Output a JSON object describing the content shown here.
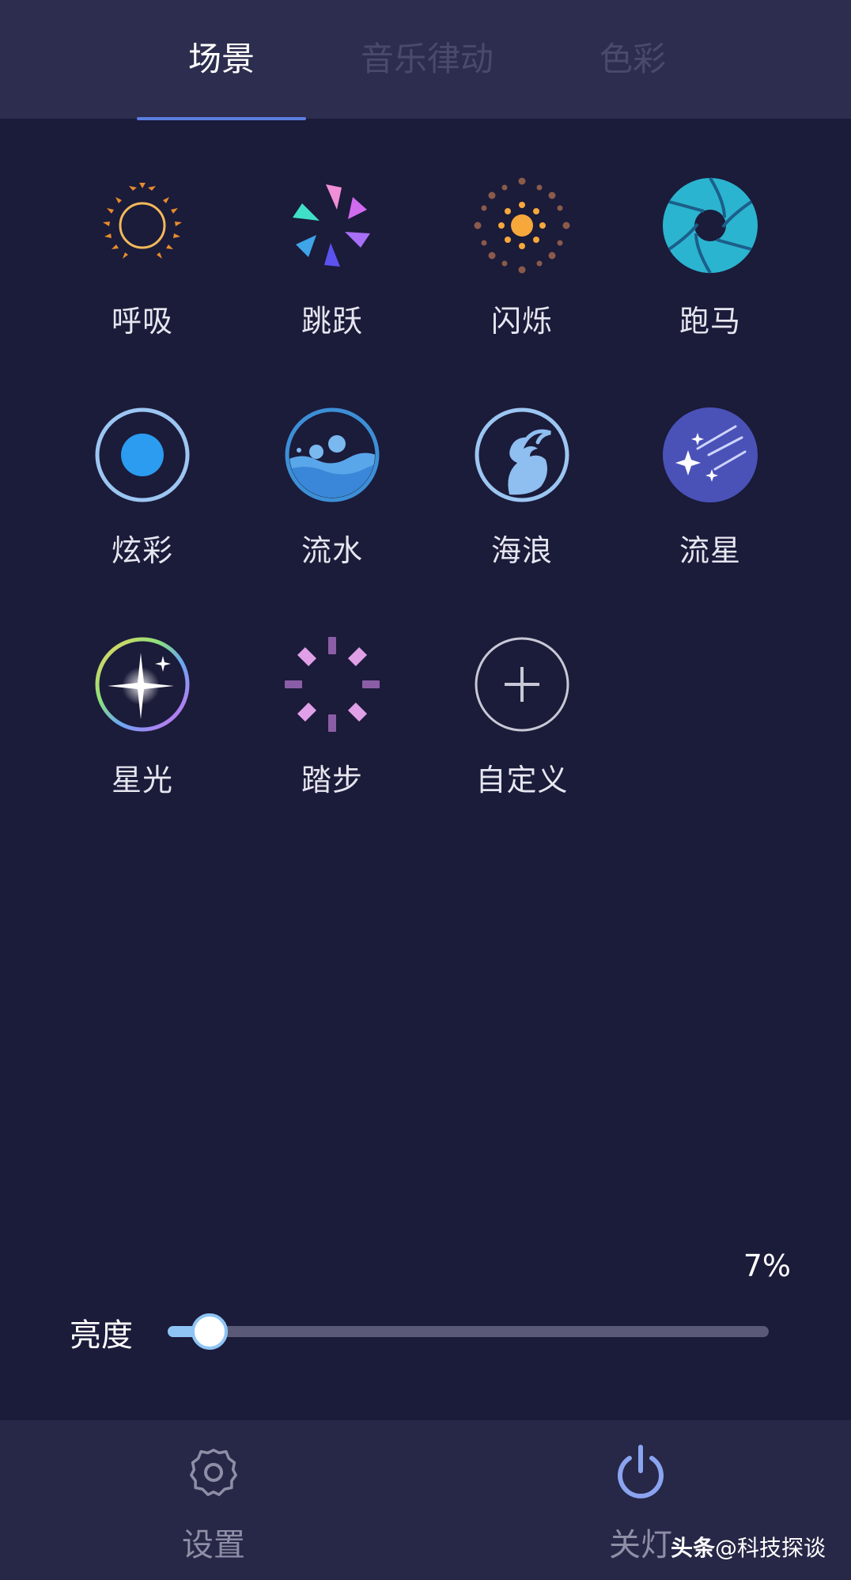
{
  "tabs": [
    {
      "label": "场景",
      "active": true
    },
    {
      "label": "音乐律动",
      "active": false
    },
    {
      "label": "色彩",
      "active": false
    }
  ],
  "scenes": [
    {
      "label": "呼吸",
      "icon": "laurel-wreath-icon"
    },
    {
      "label": "跳跃",
      "icon": "colorful-pinwheel-icon"
    },
    {
      "label": "闪烁",
      "icon": "sun-burst-icon"
    },
    {
      "label": "跑马",
      "icon": "aperture-icon"
    },
    {
      "label": "炫彩",
      "icon": "dot-ring-icon"
    },
    {
      "label": "流水",
      "icon": "water-waves-icon"
    },
    {
      "label": "海浪",
      "icon": "ocean-wave-icon"
    },
    {
      "label": "流星",
      "icon": "shooting-stars-icon"
    },
    {
      "label": "星光",
      "icon": "sparkle-ring-icon"
    },
    {
      "label": "踏步",
      "icon": "step-spinner-icon"
    },
    {
      "label": "自定义",
      "icon": "add-icon"
    }
  ],
  "brightness": {
    "label": "亮度",
    "value_text": "7%",
    "value_fraction": 0.07
  },
  "bottom": {
    "settings_label": "设置",
    "power_label": "关灯"
  },
  "watermark": {
    "brand": "头条",
    "account": "@科技探谈"
  },
  "colors": {
    "background": "#1b1b3a",
    "accent": "#5b7fe0",
    "slider_fill": "#8ec5f5"
  }
}
